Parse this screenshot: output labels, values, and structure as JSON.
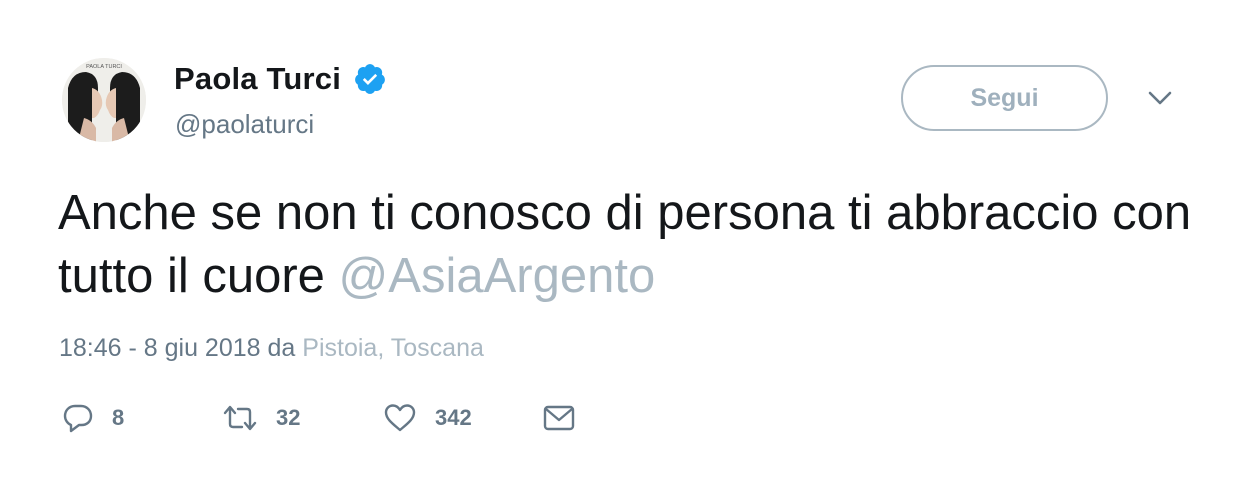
{
  "user": {
    "display_name": "Paola Turci",
    "handle": "@paolaturci",
    "verified": true,
    "avatar_caption": "PAOLA TURCI"
  },
  "follow_button": {
    "label": "Segui"
  },
  "tweet": {
    "text": "Anche se non ti conosco di persona ti abbraccio con tutto il cuore",
    "mention": "@AsiaArgento"
  },
  "meta": {
    "time_date": "18:46 - 8 giu 2018",
    "da": "da",
    "location": "Pistoia, Toscana"
  },
  "actions": {
    "replies": "8",
    "retweets": "32",
    "likes": "342"
  },
  "colors": {
    "text": "#14171a",
    "secondary": "#657786",
    "muted": "#aab8c2",
    "verified": "#1da1f2"
  },
  "icons": [
    "verified-badge-icon",
    "chevron-down-icon",
    "reply-icon",
    "retweet-icon",
    "heart-icon",
    "envelope-icon"
  ]
}
